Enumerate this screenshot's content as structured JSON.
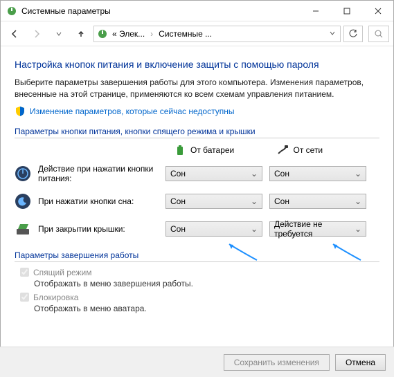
{
  "window": {
    "title": "Системные параметры"
  },
  "breadcrumb": {
    "item1": "« Элек...",
    "item2": "Системные ..."
  },
  "page": {
    "heading": "Настройка кнопок питания и включение защиты с помощью пароля",
    "description": "Выберите параметры завершения работы для этого компьютера. Изменения параметров, внесенные на этой странице, применяются ко всем схемам управления питанием.",
    "change_link": "Изменение параметров, которые сейчас недоступны"
  },
  "section_buttons": {
    "title": "Параметры кнопки питания, кнопки спящего режима и крышки",
    "col_battery": "От батареи",
    "col_ac": "От сети",
    "rows": [
      {
        "label": "Действие при нажатии кнопки питания:",
        "battery": "Сон",
        "ac": "Сон"
      },
      {
        "label": "При нажатии кнопки сна:",
        "battery": "Сон",
        "ac": "Сон"
      },
      {
        "label": "При закрытии крышки:",
        "battery": "Сон",
        "ac": "Действие не требуется"
      }
    ]
  },
  "section_shutdown": {
    "title": "Параметры завершения работы",
    "sleep_label": "Спящий режим",
    "sleep_sub": "Отображать в меню завершения работы.",
    "lock_label": "Блокировка",
    "lock_sub": "Отображать в меню аватара."
  },
  "footer": {
    "save": "Сохранить изменения",
    "cancel": "Отмена"
  }
}
